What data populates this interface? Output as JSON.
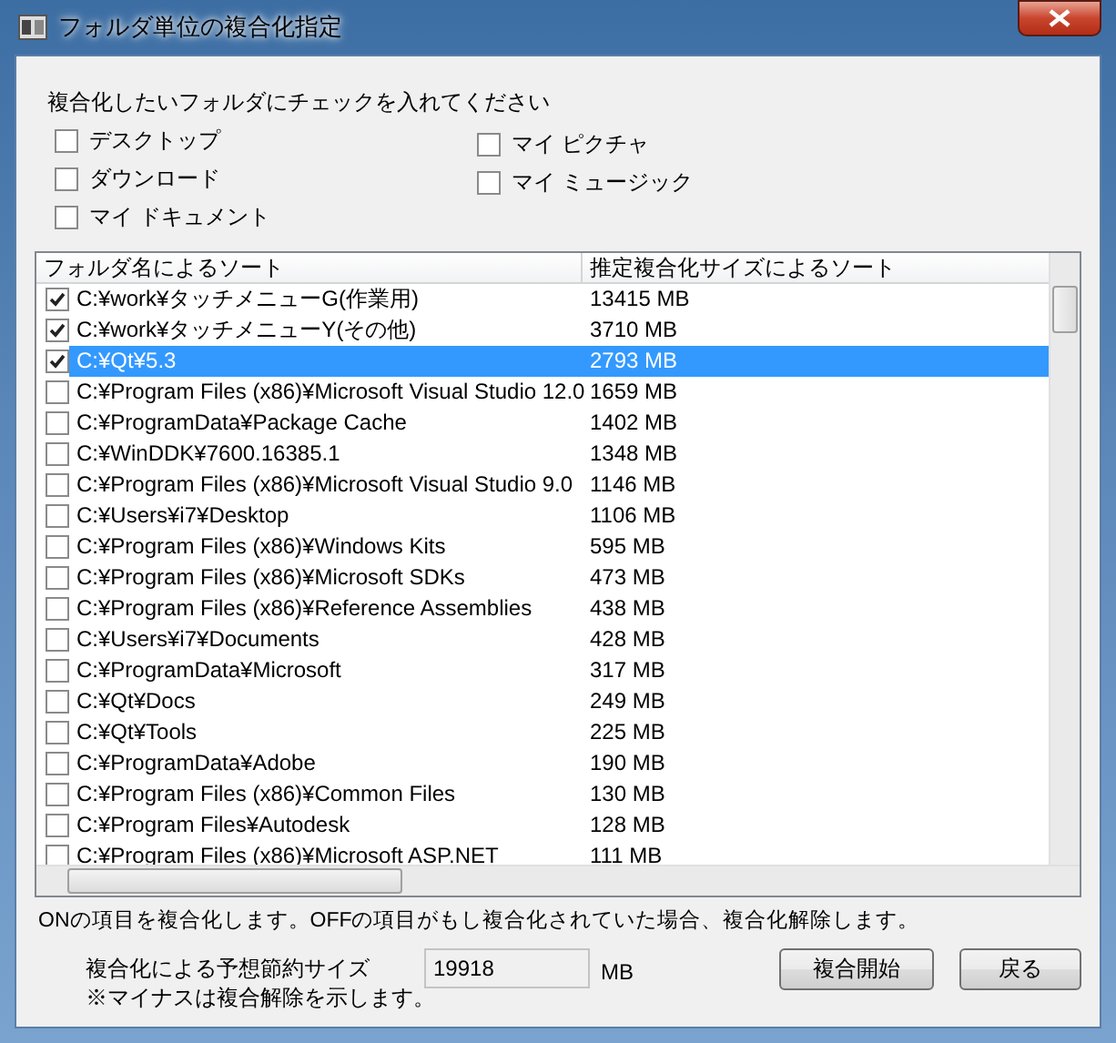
{
  "window": {
    "title": "フォルダ単位の複合化指定"
  },
  "instruction": "複合化したいフォルダにチェックを入れてください",
  "option_columns": [
    [
      {
        "label": "デスクトップ",
        "checked": false
      },
      {
        "label": "ダウンロード",
        "checked": false
      },
      {
        "label": "マイ ドキュメント",
        "checked": false
      }
    ],
    [
      {
        "label": "マイ ピクチャ",
        "checked": false
      },
      {
        "label": "マイ ミュージック",
        "checked": false
      }
    ]
  ],
  "table": {
    "columns": [
      "フォルダ名によるソート",
      "推定複合化サイズによるソート"
    ],
    "rows": [
      {
        "path": "C:¥work¥タッチメニューG(作業用)",
        "size": "13415 MB",
        "checked": true,
        "selected": false
      },
      {
        "path": "C:¥work¥タッチメニューY(その他)",
        "size": "3710 MB",
        "checked": true,
        "selected": false
      },
      {
        "path": "C:¥Qt¥5.3",
        "size": "2793 MB",
        "checked": true,
        "selected": true
      },
      {
        "path": "C:¥Program Files (x86)¥Microsoft Visual Studio 12.0",
        "size": "1659 MB",
        "checked": false,
        "selected": false
      },
      {
        "path": "C:¥ProgramData¥Package Cache",
        "size": "1402 MB",
        "checked": false,
        "selected": false
      },
      {
        "path": "C:¥WinDDK¥7600.16385.1",
        "size": "1348 MB",
        "checked": false,
        "selected": false
      },
      {
        "path": "C:¥Program Files (x86)¥Microsoft Visual Studio 9.0",
        "size": "1146 MB",
        "checked": false,
        "selected": false
      },
      {
        "path": "C:¥Users¥i7¥Desktop",
        "size": "1106 MB",
        "checked": false,
        "selected": false
      },
      {
        "path": "C:¥Program Files (x86)¥Windows Kits",
        "size": "595 MB",
        "checked": false,
        "selected": false
      },
      {
        "path": "C:¥Program Files (x86)¥Microsoft SDKs",
        "size": "473 MB",
        "checked": false,
        "selected": false
      },
      {
        "path": "C:¥Program Files (x86)¥Reference Assemblies",
        "size": "438 MB",
        "checked": false,
        "selected": false
      },
      {
        "path": "C:¥Users¥i7¥Documents",
        "size": "428 MB",
        "checked": false,
        "selected": false
      },
      {
        "path": "C:¥ProgramData¥Microsoft",
        "size": "317 MB",
        "checked": false,
        "selected": false
      },
      {
        "path": "C:¥Qt¥Docs",
        "size": "249 MB",
        "checked": false,
        "selected": false
      },
      {
        "path": "C:¥Qt¥Tools",
        "size": "225 MB",
        "checked": false,
        "selected": false
      },
      {
        "path": "C:¥ProgramData¥Adobe",
        "size": "190 MB",
        "checked": false,
        "selected": false
      },
      {
        "path": "C:¥Program Files (x86)¥Common Files",
        "size": "130 MB",
        "checked": false,
        "selected": false
      },
      {
        "path": "C:¥Program Files¥Autodesk",
        "size": "128 MB",
        "checked": false,
        "selected": false
      },
      {
        "path": "C:¥Program Files (x86)¥Microsoft ASP.NET",
        "size": "111 MB",
        "checked": false,
        "selected": false
      }
    ]
  },
  "note": "ONの項目を複合化します。OFFの項目がもし複合化されていた場合、複合化解除します。",
  "savings": {
    "label": "複合化による予想節約サイズ",
    "value": "19918",
    "unit": "MB",
    "remark": "※マイナスは複合解除を示します。"
  },
  "buttons": [
    "複合開始",
    "戻る"
  ]
}
